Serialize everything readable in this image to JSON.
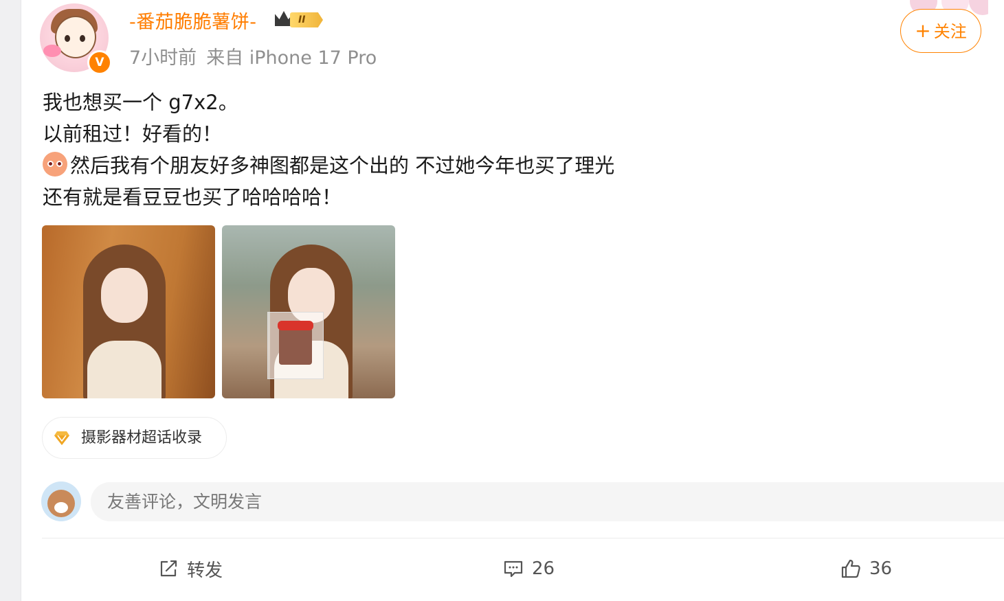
{
  "post": {
    "author": {
      "name": "-番茄脆脆薯饼-",
      "level": "II",
      "verified_mark": "V"
    },
    "meta": {
      "time": "7小时前",
      "source": "来自 iPhone 17 Pro"
    },
    "follow_label": "关注",
    "follow_plus": "+",
    "text_lines": [
      "我也想买一个 g7x2。",
      "以前租过！好看的！",
      "然后我有个朋友好多神图都是这个出的 不过她今年也买了理光",
      "还有就是看豆豆也买了哈哈哈哈！"
    ],
    "images": [
      {
        "name": "photo-girl-portrait"
      },
      {
        "name": "photo-girl-with-cake"
      }
    ],
    "topic_tag": "摄影器材超话收录"
  },
  "comment": {
    "placeholder": "友善评论，文明发言"
  },
  "actions": {
    "repost_label": "转发",
    "comment_count": "26",
    "like_count": "36"
  },
  "colors": {
    "accent": "#ff8200",
    "username": "#ff7d00",
    "meta": "#8f8f8f",
    "tag_gem": "#f5b940"
  },
  "icons": {
    "repost": "share-edit-icon",
    "comment": "comment-bubble-icon",
    "like": "thumbs-up-icon",
    "topic": "diamond-icon"
  }
}
